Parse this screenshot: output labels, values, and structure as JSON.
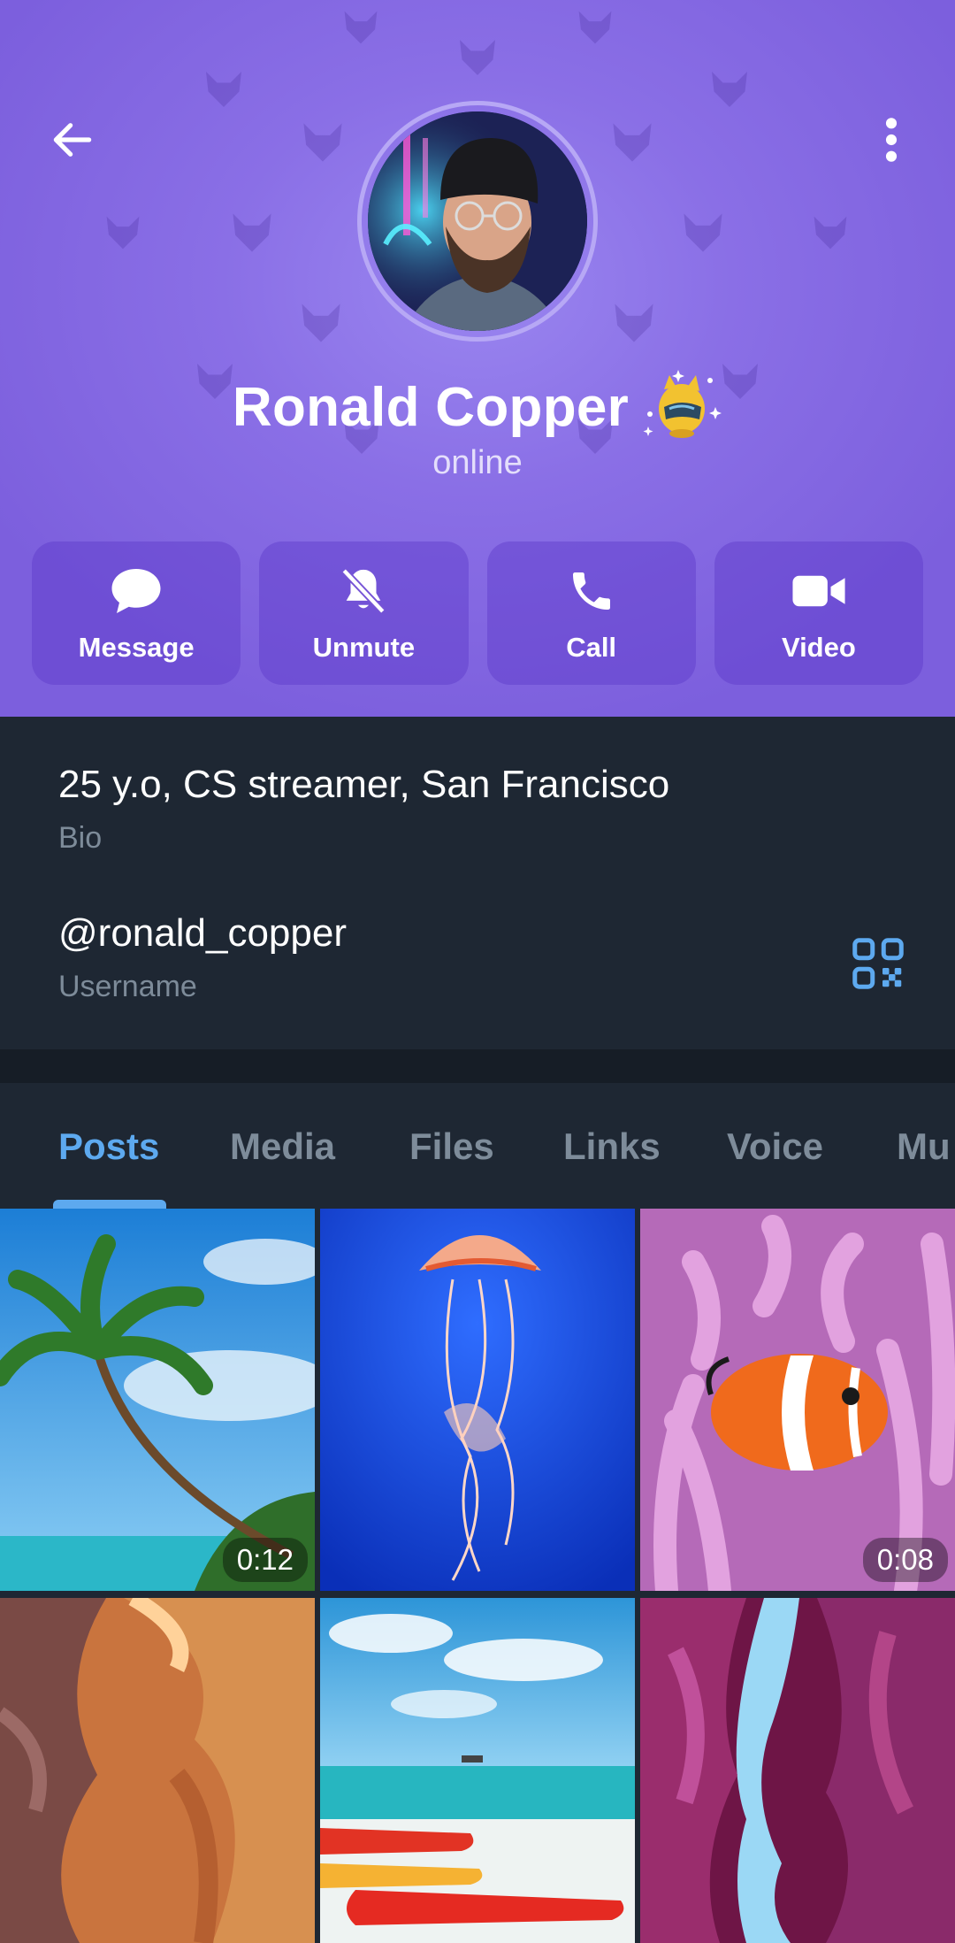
{
  "profile": {
    "name": "Ronald Copper",
    "status": "online",
    "avatar_icon": "profile-photo"
  },
  "toolbar": {
    "back_icon": "arrow-left-icon",
    "more_icon": "more-vertical-icon"
  },
  "actions": [
    {
      "label": "Message",
      "icon": "chat-bubble-icon"
    },
    {
      "label": "Unmute",
      "icon": "bell-off-icon"
    },
    {
      "label": "Call",
      "icon": "phone-icon"
    },
    {
      "label": "Video",
      "icon": "video-camera-icon"
    }
  ],
  "info": {
    "bio": {
      "value": "25 y.o, CS streamer, San Francisco",
      "label": "Bio"
    },
    "username": {
      "value": "@ronald_copper",
      "label": "Username"
    }
  },
  "tabs": [
    {
      "label": "Posts",
      "active": true
    },
    {
      "label": "Media",
      "active": false
    },
    {
      "label": "Files",
      "active": false
    },
    {
      "label": "Links",
      "active": false
    },
    {
      "label": "Voice",
      "active": false
    },
    {
      "label": "Mu",
      "active": false
    }
  ],
  "media": [
    {
      "scene": "palm-beach",
      "duration": "0:12"
    },
    {
      "scene": "jellyfish",
      "duration": ""
    },
    {
      "scene": "clownfish",
      "duration": "0:08"
    },
    {
      "scene": "canyon",
      "duration": ""
    },
    {
      "scene": "kayaks-beach",
      "duration": ""
    },
    {
      "scene": "purple-canyon",
      "duration": ""
    }
  ],
  "colors": {
    "header_bg": "#8a6fe6",
    "accent": "#5da9ef",
    "surface": "#1e2733",
    "label_gray": "#7d8b99"
  }
}
